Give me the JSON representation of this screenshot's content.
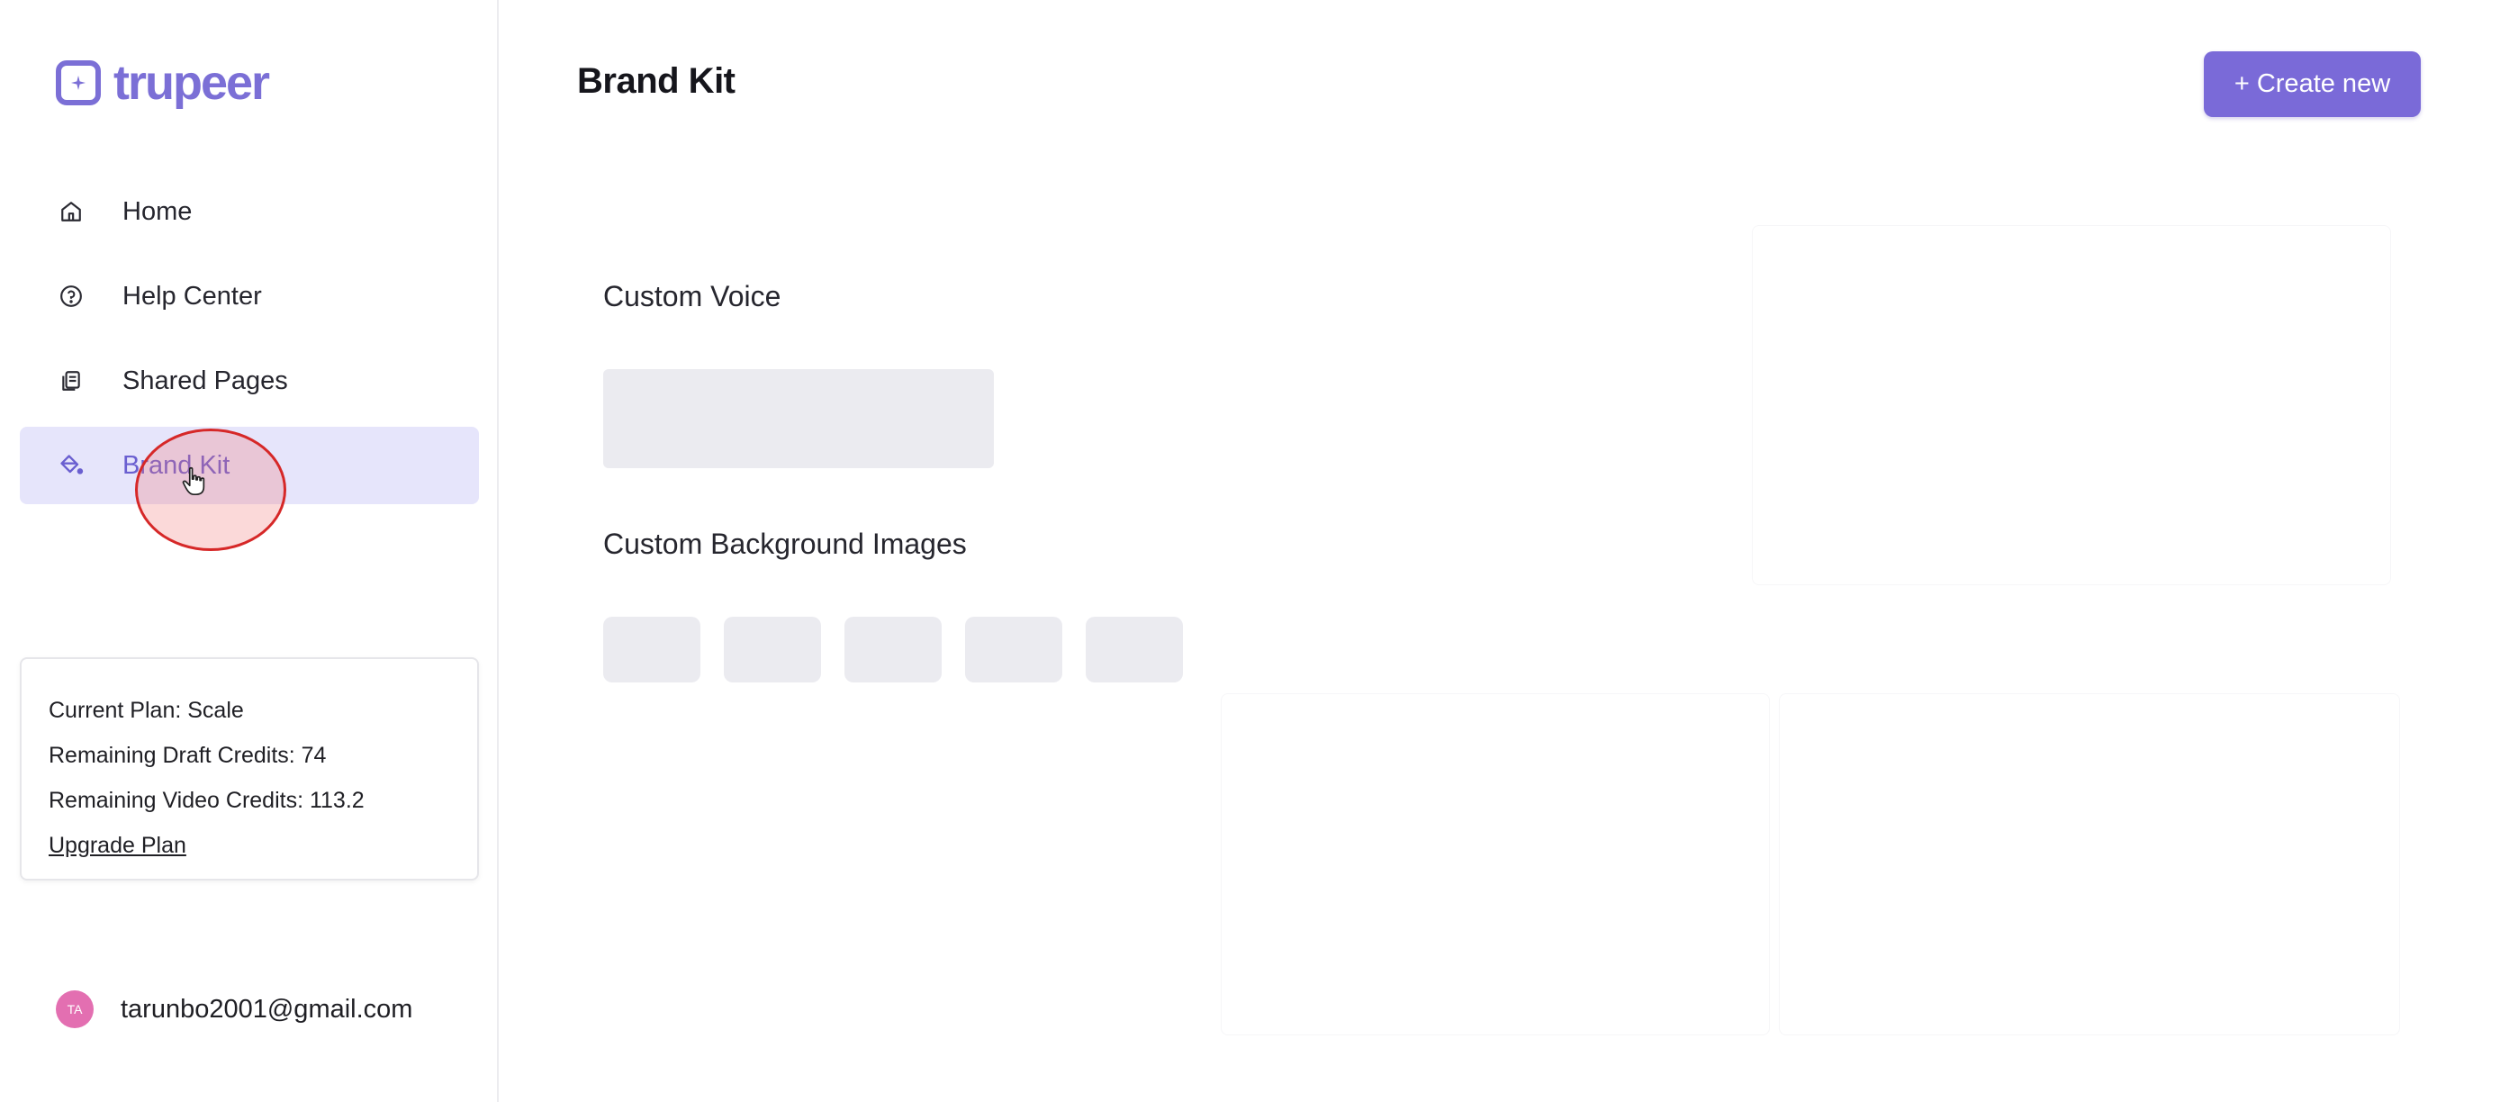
{
  "app": {
    "brand_name": "trupeer",
    "accent_color": "#7b6fd6"
  },
  "sidebar": {
    "items": [
      {
        "label": "Home",
        "icon": "home-icon"
      },
      {
        "label": "Help Center",
        "icon": "help-circle-icon"
      },
      {
        "label": "Shared Pages",
        "icon": "shared-pages-icon"
      },
      {
        "label": "Brand Kit",
        "icon": "paint-bucket-icon",
        "active": true
      }
    ]
  },
  "plan": {
    "current_plan": "Current Plan: Scale",
    "draft_credits": "Remaining Draft Credits: 74",
    "video_credits": "Remaining Video Credits: 113.2",
    "upgrade_label": "Upgrade Plan"
  },
  "user": {
    "initials": "TA",
    "email": "tarunbo2001@gmail.com",
    "avatar_color": "#e36fb1"
  },
  "main": {
    "title": "Brand Kit",
    "create_button": "+ Create new",
    "sections": {
      "voice_title": "Custom Voice",
      "backgrounds_title": "Custom Background Images"
    }
  }
}
